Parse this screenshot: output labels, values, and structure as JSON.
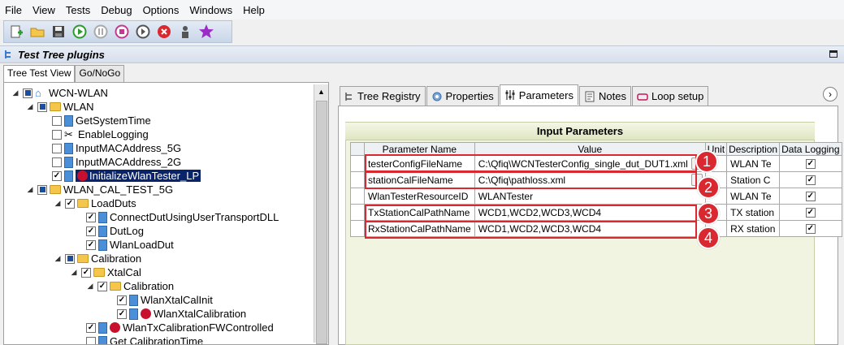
{
  "menu": [
    "File",
    "View",
    "Tests",
    "Debug",
    "Options",
    "Windows",
    "Help"
  ],
  "toolbar_icons": [
    "new-test-icon",
    "open-folder-icon",
    "save-icon",
    "run-icon",
    "pause-icon",
    "stop-icon",
    "step-icon",
    "cancel-icon",
    "user-icon",
    "favorite-star-icon"
  ],
  "panel": {
    "title": "Test Tree plugins"
  },
  "left_tabs": [
    "Tree Test View",
    "Go/NoGo"
  ],
  "tree": [
    {
      "label": "WCN-WLAN"
    },
    {
      "label": "WLAN"
    },
    {
      "label": "GetSystemTime"
    },
    {
      "label": "EnableLogging"
    },
    {
      "label": "InputMACAddress_5G"
    },
    {
      "label": "InputMACAddress_2G"
    },
    {
      "label": "InitializeWlanTester_LP"
    },
    {
      "label": "WLAN_CAL_TEST_5G"
    },
    {
      "label": "LoadDuts"
    },
    {
      "label": "ConnectDutUsingUserTransportDLL"
    },
    {
      "label": "DutLog"
    },
    {
      "label": "WlanLoadDut"
    },
    {
      "label": "Calibration"
    },
    {
      "label": "XtalCal"
    },
    {
      "label": "Calibration"
    },
    {
      "label": "WlanXtalCalInit"
    },
    {
      "label": "WlanXtalCalibration"
    },
    {
      "label": "WlanTxCalibrationFWControlled"
    },
    {
      "label": "Get CalibrationTime"
    }
  ],
  "right_tabs": [
    "Tree Registry",
    "Properties",
    "Parameters",
    "Notes",
    "Loop setup"
  ],
  "input_params": {
    "title": "Input Parameters",
    "columns": [
      "",
      "Parameter Name",
      "Value",
      "Unit",
      "Description",
      "Data Logging"
    ],
    "rows": [
      {
        "name": "testerConfigFileName",
        "value": "C:\\Qfiq\\WCNTesterConfig_single_dut_DUT1.xml",
        "unit": "",
        "desc": "WLAN Te",
        "log": true
      },
      {
        "name": "stationCalFileName",
        "value": "C:\\Qfiq\\pathloss.xml",
        "unit": "",
        "desc": "Station C",
        "log": true
      },
      {
        "name": "WlanTesterResourceID",
        "value": "WLANTester",
        "unit": "",
        "desc": "WLAN Te",
        "log": true
      },
      {
        "name": "TxStationCalPathName",
        "value": "WCD1,WCD2,WCD3,WCD4",
        "unit": "",
        "desc": "TX station",
        "log": true
      },
      {
        "name": "RxStationCalPathName",
        "value": "WCD1,WCD2,WCD3,WCD4",
        "unit": "",
        "desc": "RX station",
        "log": true
      }
    ]
  },
  "badges": [
    "1",
    "2",
    "3",
    "4"
  ],
  "colors": {
    "annotation_red": "#d9282f",
    "selection": "#0a246a"
  }
}
